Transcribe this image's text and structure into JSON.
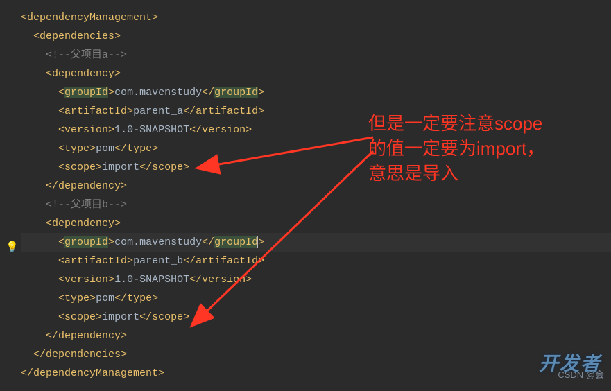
{
  "code": {
    "dependencyManagement_open": "dependencyManagement",
    "dependencies_open": "dependencies",
    "comment_a": "<!--父项目a-->",
    "dependency_open": "dependency",
    "groupId_tag": "groupId",
    "groupId_text": "com.mavenstudy",
    "artifactId_tag": "artifactId",
    "artifactId_a": "parent_a",
    "version_tag": "version",
    "version_text": "1.0-SNAPSHOT",
    "type_tag": "type",
    "type_text": "pom",
    "scope_tag": "scope",
    "scope_text": "import",
    "dependency_close": "dependency",
    "comment_b": "<!--父项目b-->",
    "artifactId_b": "parent_b",
    "dependencies_close": "dependencies",
    "dependencyManagement_close": "dependencyManagement"
  },
  "annotation": {
    "line1": "但是一定要注意scope",
    "line2": "的值一定要为import，",
    "line3": "意思是导入"
  },
  "watermark": {
    "brand": "开发者",
    "credit": "CSDN @会"
  }
}
